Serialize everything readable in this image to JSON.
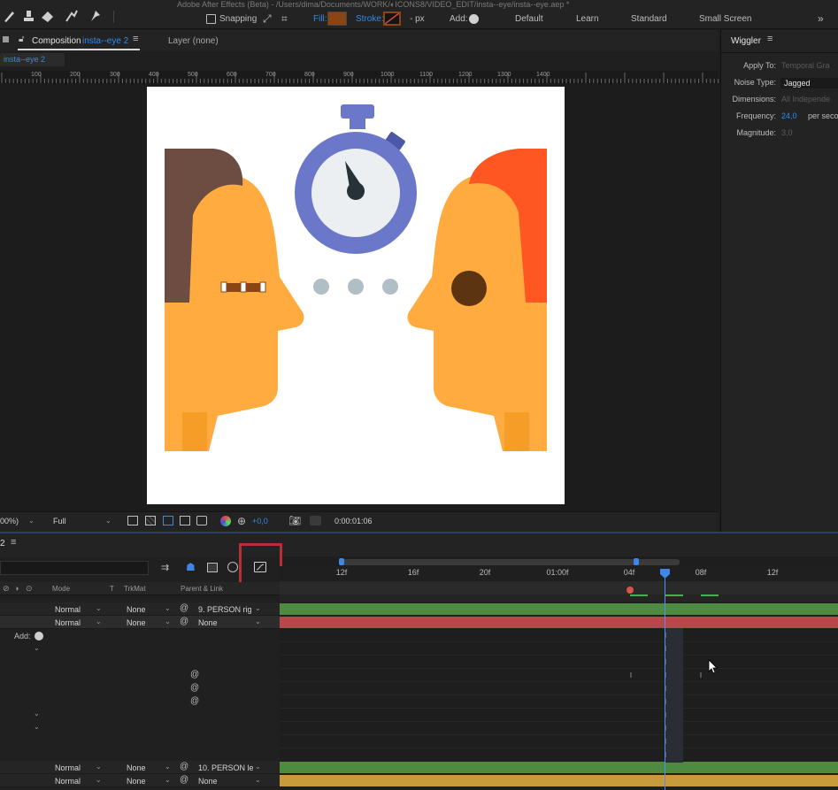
{
  "window": {
    "title": "Adobe After Effects (Beta) - /Users/dima/Documents/WORK/◐ICONS8/VIDEO_EDIT/insta--eye/insta--eye.aep *"
  },
  "toolbar": {
    "snapping_label": "Snapping",
    "fill_label": "Fill:",
    "stroke_label": "Stroke:",
    "stroke_px": "- px",
    "add_label": "Add:",
    "fill_color": "#8b4513",
    "workspaces": [
      "Default",
      "Learn",
      "Standard",
      "Small Screen"
    ],
    "more": "»"
  },
  "composition_panel": {
    "tab_prefix": "Composition",
    "tab_name": "insta--eye 2",
    "layer_tab": "Layer (none)",
    "breadcrumb": "insta--eye 2",
    "ruler_ticks": [
      "100",
      "200",
      "300",
      "400",
      "500",
      "600",
      "700",
      "800",
      "900",
      "1000",
      "1100",
      "1200",
      "1300",
      "1400"
    ],
    "footer": {
      "zoom": "00%)",
      "resolution": "Full",
      "exposure": "+0,0",
      "timecode": "0:00:01:06"
    }
  },
  "wiggler": {
    "title": "Wiggler",
    "apply_to_label": "Apply To:",
    "apply_to_value": "Temporal Gra",
    "noise_type_label": "Noise Type:",
    "noise_type_value": "Jagged",
    "dimensions_label": "Dimensions:",
    "dimensions_value": "All Independe",
    "frequency_label": "Frequency:",
    "frequency_value": "24,0",
    "frequency_unit": "per seco",
    "magnitude_label": "Magnitude:",
    "magnitude_value": "3,0"
  },
  "timeline": {
    "tab_name": "2",
    "columns": {
      "mode": "Mode",
      "t": "T",
      "trkmat": "TrkMat",
      "parent": "Parent & Link"
    },
    "time_labels": [
      "12f",
      "16f",
      "20f",
      "01:00f",
      "04f",
      "08f",
      "12f"
    ],
    "add_label": "Add:",
    "rows": [
      {
        "mode": "Normal",
        "trkmat": "None",
        "parent": "9. PERSON rig",
        "color": "#4e8a3f"
      },
      {
        "mode": "Normal",
        "trkmat": "None",
        "parent": "None",
        "color": "#b8474b"
      },
      {
        "mode": "Normal",
        "trkmat": "None",
        "parent": "10. PERSON le",
        "color": "#4e8a3f"
      },
      {
        "mode": "Normal",
        "trkmat": "None",
        "parent": "None",
        "color": "#c79a3c"
      }
    ],
    "colors": {
      "playhead": "#3f86e6",
      "highlight_box": "#b92f37"
    }
  },
  "artwork": {
    "skin": "#ffab40",
    "skin_dark": "#f59d26",
    "left_hair": "#6d4c41",
    "right_hair": "#ff5722",
    "eye": "#5d3411",
    "watch_ring": "#6b77c9",
    "watch_face": "#eceff1",
    "dots": "#b0bec5"
  }
}
